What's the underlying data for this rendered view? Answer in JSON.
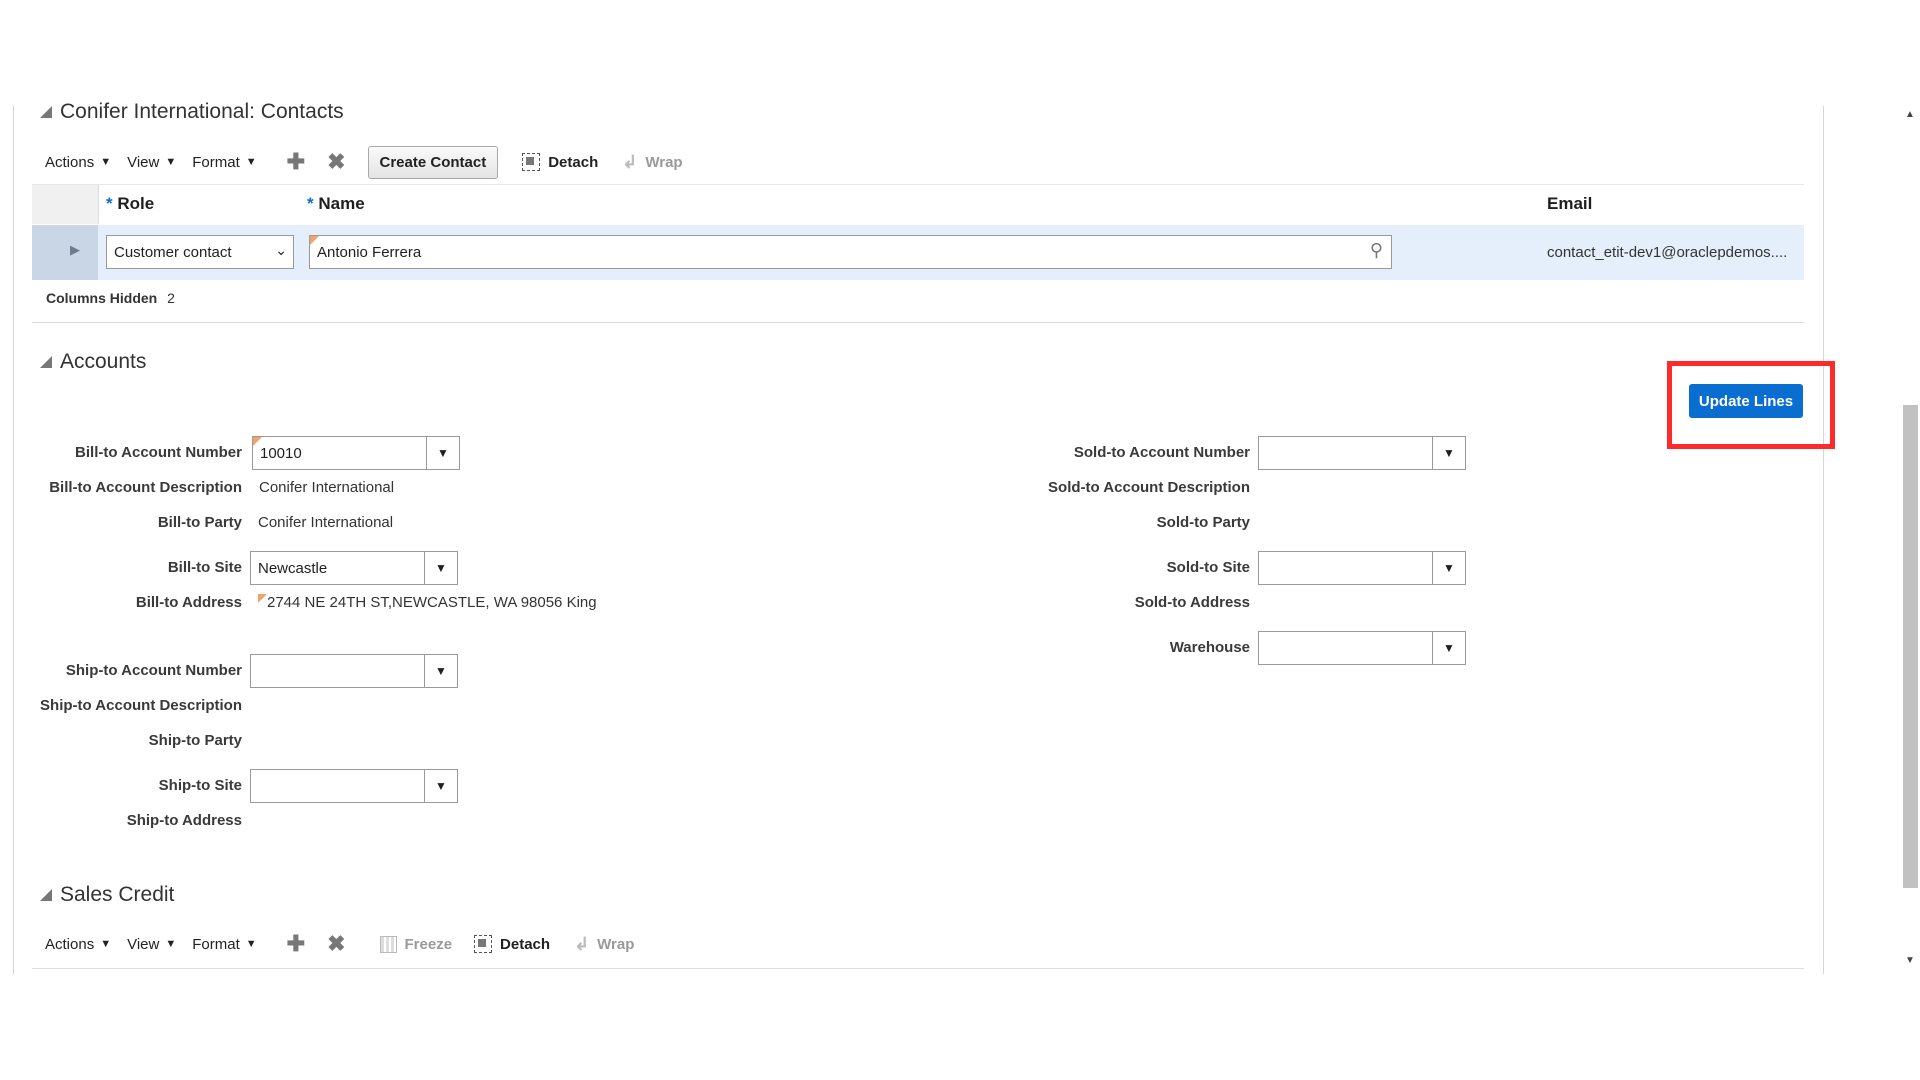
{
  "contacts": {
    "title": "Conifer International: Contacts",
    "toolbar": {
      "actions": "Actions",
      "view": "View",
      "format": "Format",
      "create_contact": "Create Contact",
      "detach": "Detach",
      "wrap": "Wrap"
    },
    "columns": {
      "role": "Role",
      "name": "Name",
      "email": "Email",
      "required_mark": "*"
    },
    "row": {
      "role": "Customer contact",
      "name": "Antonio Ferrera",
      "email": "contact_etit-dev1@oraclepdemos...."
    },
    "columns_hidden_label": "Columns Hidden",
    "columns_hidden_count": "2"
  },
  "accounts": {
    "title": "Accounts",
    "update_lines": "Update Lines",
    "bill_to": {
      "account_number_label": "Bill-to Account Number",
      "account_number": "10010",
      "account_description_label": "Bill-to Account Description",
      "account_description": "Conifer International",
      "party_label": "Bill-to Party",
      "party": "Conifer International",
      "site_label": "Bill-to Site",
      "site": "Newcastle",
      "address_label": "Bill-to Address",
      "address": "2744 NE 24TH ST,NEWCASTLE, WA 98056 King"
    },
    "ship_to": {
      "account_number_label": "Ship-to Account Number",
      "account_description_label": "Ship-to Account Description",
      "party_label": "Ship-to Party",
      "site_label": "Ship-to Site",
      "address_label": "Ship-to Address"
    },
    "sold_to": {
      "account_number_label": "Sold-to Account Number",
      "account_description_label": "Sold-to Account Description",
      "party_label": "Sold-to Party",
      "site_label": "Sold-to Site",
      "address_label": "Sold-to Address",
      "warehouse_label": "Warehouse"
    }
  },
  "sales_credit": {
    "title": "Sales Credit",
    "toolbar": {
      "actions": "Actions",
      "view": "View",
      "format": "Format",
      "freeze": "Freeze",
      "detach": "Detach",
      "wrap": "Wrap"
    }
  },
  "colors": {
    "accent": "#0a6ed1",
    "highlight": "#ff2a2a",
    "selected_row": "#e4effb"
  }
}
